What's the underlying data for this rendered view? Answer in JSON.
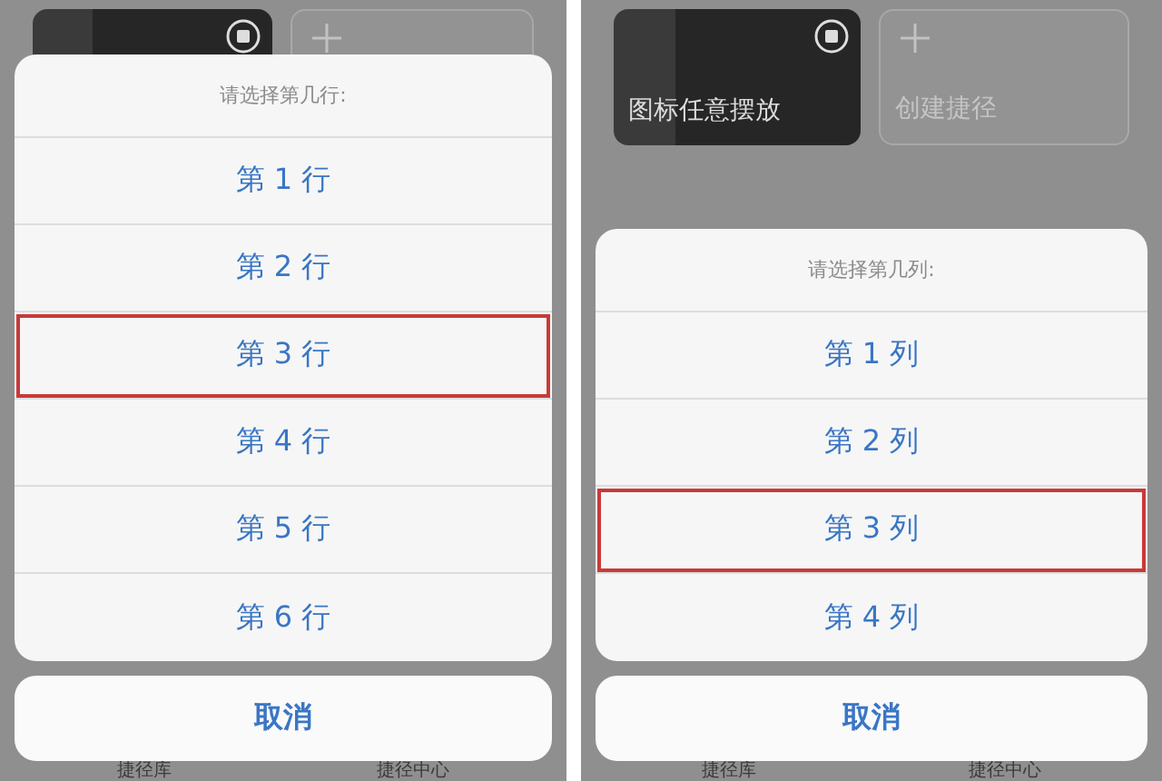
{
  "screens": [
    {
      "cards": [
        {
          "kind": "shortcut"
        },
        {
          "kind": "create"
        }
      ],
      "sheet": {
        "title": "请选择第几行:",
        "options": [
          {
            "label": "第 1 行",
            "selected": false
          },
          {
            "label": "第 2 行",
            "selected": false
          },
          {
            "label": "第 3 行",
            "selected": true
          },
          {
            "label": "第 4 行",
            "selected": false
          },
          {
            "label": "第 5 行",
            "selected": false
          },
          {
            "label": "第 6 行",
            "selected": false
          }
        ],
        "cancel": "取消"
      },
      "tab_bar": [
        "捷径库",
        "捷径中心"
      ]
    },
    {
      "cards": [
        {
          "kind": "shortcut",
          "label": "图标任意摆放"
        },
        {
          "kind": "create",
          "label": "创建捷径"
        }
      ],
      "sheet": {
        "title": "请选择第几列:",
        "options": [
          {
            "label": "第 1 列",
            "selected": false
          },
          {
            "label": "第 2 列",
            "selected": false
          },
          {
            "label": "第 3 列",
            "selected": true
          },
          {
            "label": "第 4 列",
            "selected": false
          }
        ],
        "cancel": "取消"
      },
      "tab_bar": [
        "捷径库",
        "捷径中心"
      ]
    }
  ]
}
